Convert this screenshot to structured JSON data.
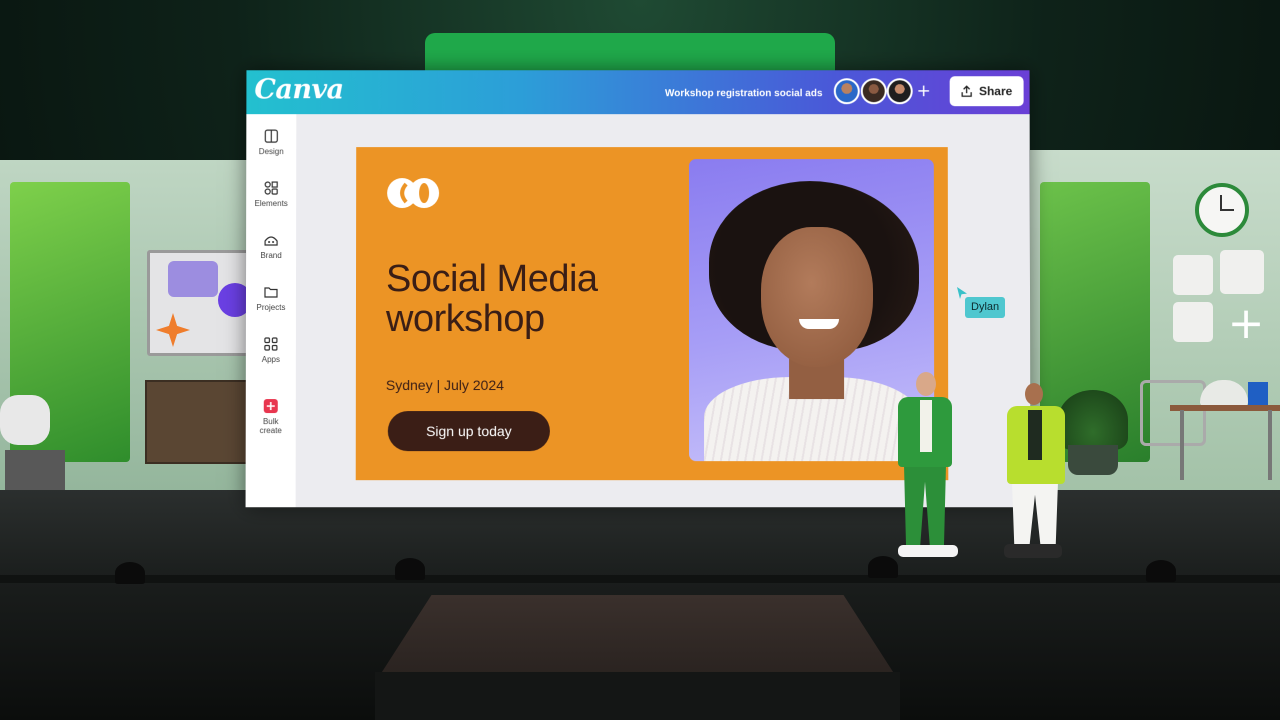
{
  "app": {
    "logo_text": "Canva",
    "document_title": "Workshop registration social ads",
    "share_label": "Share"
  },
  "sidebar": {
    "items": [
      {
        "label": "Design",
        "icon": "layout-icon"
      },
      {
        "label": "Elements",
        "icon": "shapes-icon"
      },
      {
        "label": "Brand",
        "icon": "brand-icon"
      },
      {
        "label": "Projects",
        "icon": "folder-icon"
      },
      {
        "label": "Apps",
        "icon": "apps-grid-icon"
      },
      {
        "label": "Bulk create",
        "icon": "bulk-create-icon"
      }
    ]
  },
  "design": {
    "headline": "Social Media workshop",
    "subline": "Sydney | July 2024",
    "cta_label": "Sign up today"
  },
  "collaborators": {
    "cursor_name": "Dylan"
  },
  "colors": {
    "canvas_orange": "#ec9425",
    "text_brown": "#3a1e16",
    "cursor_teal": "#4fc7cf",
    "topbar_start": "#23c0cf",
    "topbar_end": "#6a3fd6"
  }
}
